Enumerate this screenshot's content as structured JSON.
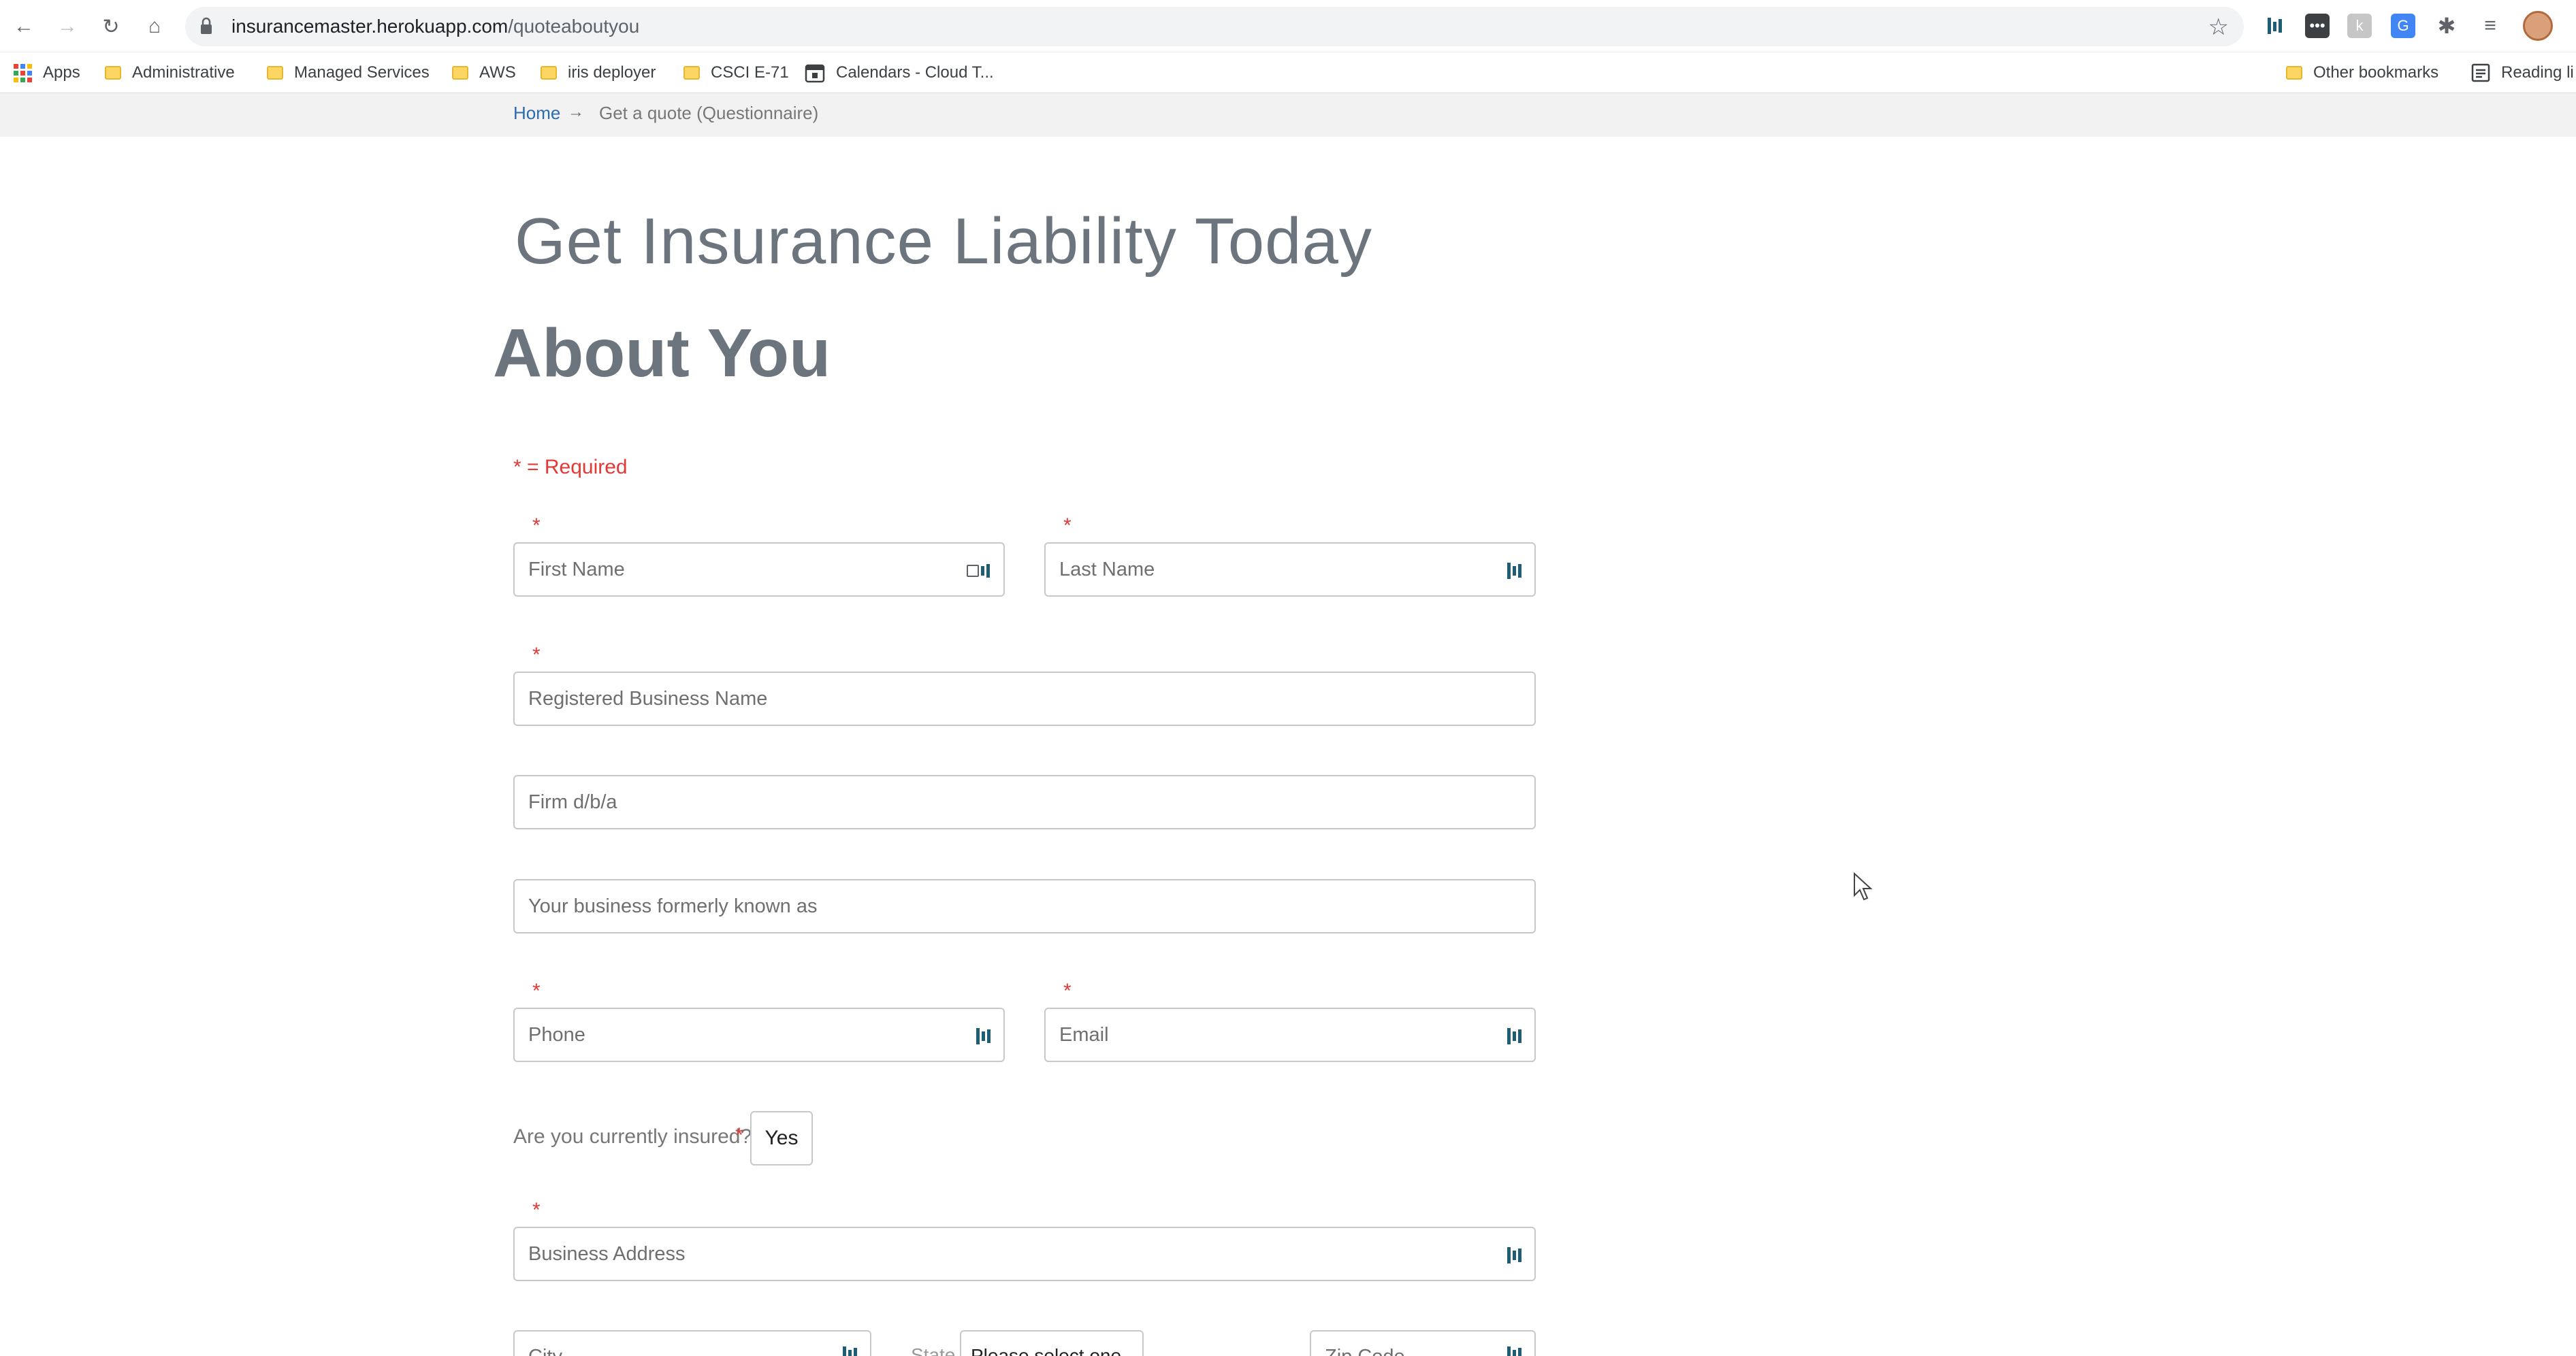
{
  "browser": {
    "url_host": "insurancemaster.herokuapp.com",
    "url_path": "/quoteaboutyou",
    "bookmarks": [
      "Apps",
      "Administrative",
      "Managed Services",
      "AWS",
      "iris deployer",
      "CSCI E-71",
      "Calendars - Cloud T...",
      "Other bookmarks",
      "Reading li"
    ]
  },
  "breadcrumb": {
    "home": "Home",
    "arrow": "→",
    "current": "Get a quote (Questionnaire)"
  },
  "page": {
    "title": "Get Insurance Liability Today",
    "section": "About You",
    "required_note": "* = Required",
    "required_marker": "*"
  },
  "form": {
    "first_name_placeholder": "First Name",
    "last_name_placeholder": "Last Name",
    "business_name_placeholder": "Registered Business Name",
    "dba_placeholder": "Firm d/b/a",
    "formerly_placeholder": "Your business formerly known as",
    "phone_placeholder": "Phone",
    "email_placeholder": "Email",
    "insured_label": "Are you currently insured?",
    "insured_value": "Yes",
    "address_placeholder": "Business Address",
    "city_placeholder": "City",
    "state_label": "State",
    "state_value": "Please select one",
    "zip_placeholder": "Zip Code"
  }
}
